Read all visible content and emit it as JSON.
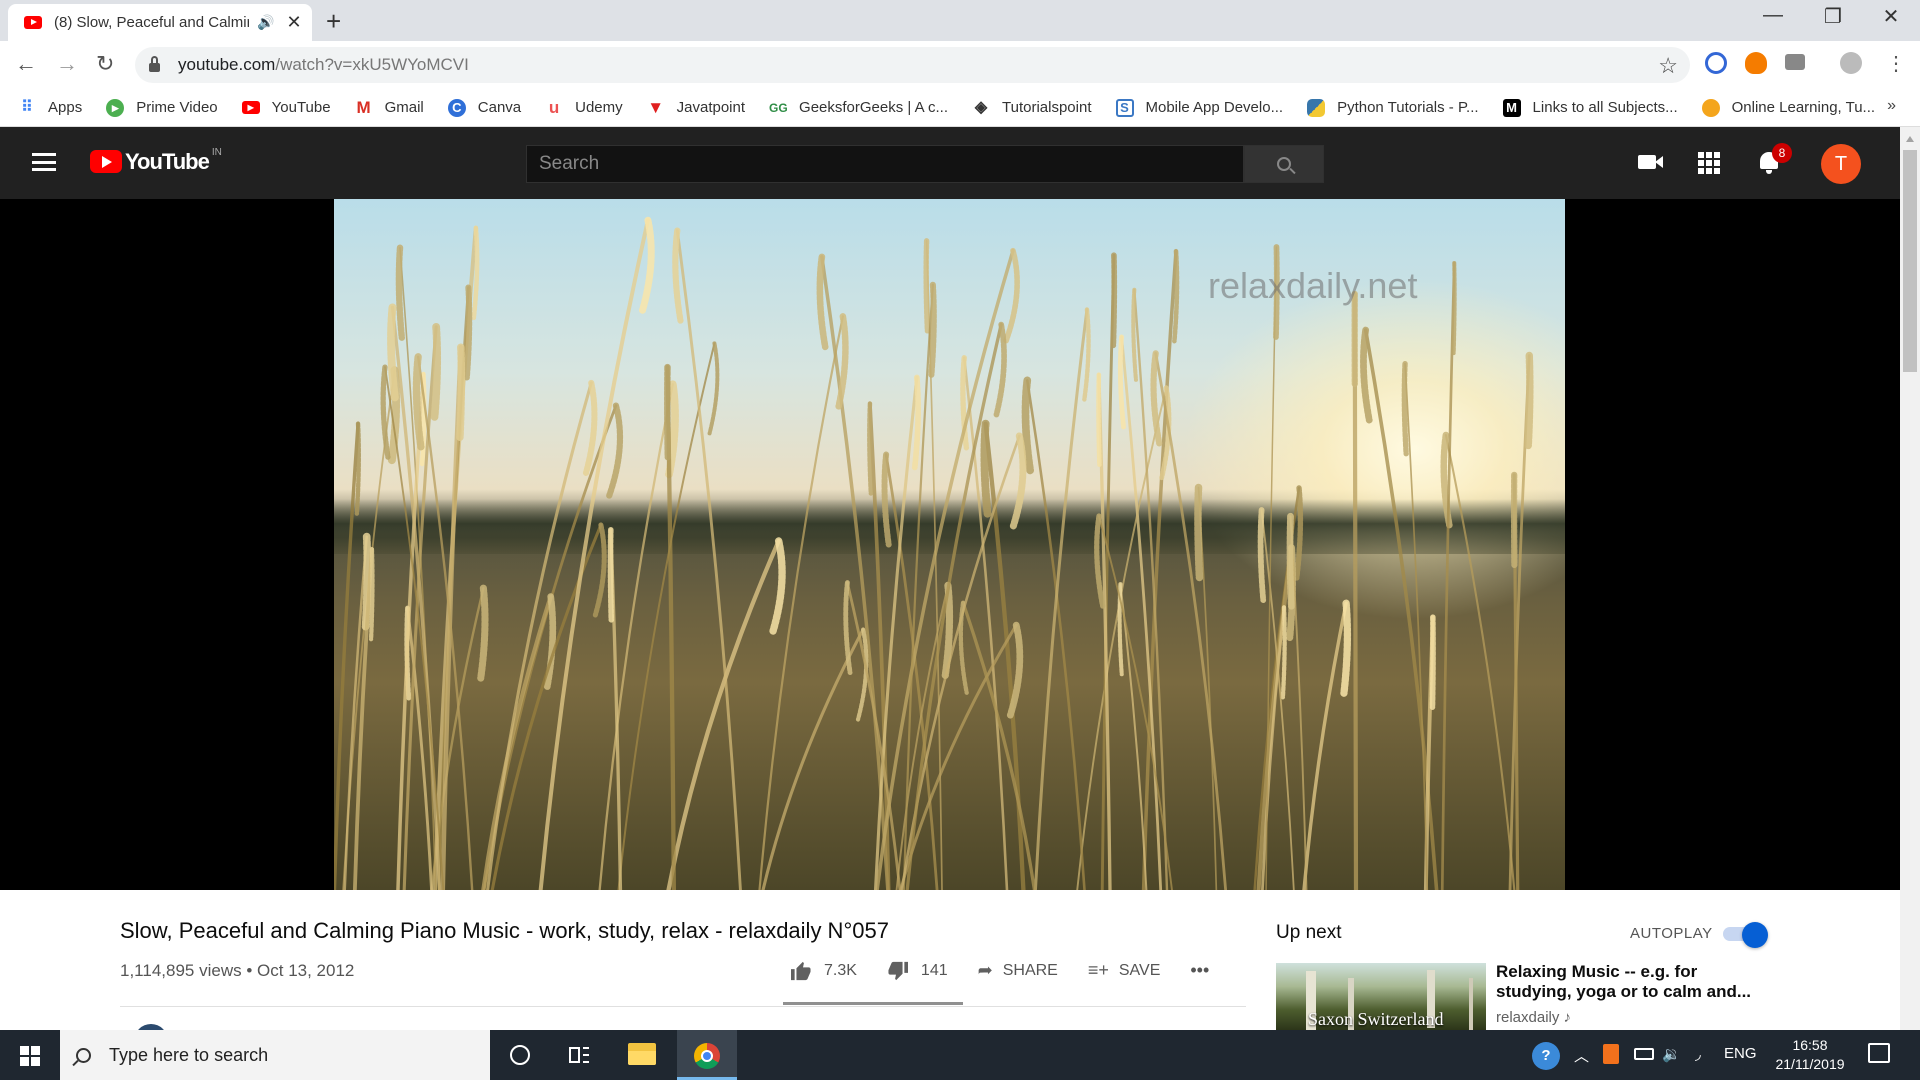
{
  "browser": {
    "tab_title": "(8) Slow, Peaceful and Calmir",
    "new_tab_symbol": "+",
    "url_host": "youtube.com",
    "url_path": "/watch?v=xkU5WYoMCVI",
    "window_controls": {
      "minimize": "—",
      "restore": "❐",
      "close": "✕"
    },
    "nav": {
      "back": "←",
      "forward": "→",
      "reload": "↻"
    }
  },
  "bookmarks": {
    "items": [
      {
        "label": "Apps",
        "icon": "apps-grid-icon",
        "color": "#4285f4"
      },
      {
        "label": "Prime Video",
        "icon": "prime-video-icon",
        "color": "#4caf50"
      },
      {
        "label": "YouTube",
        "icon": "youtube-icon",
        "color": "#ff0000"
      },
      {
        "label": "Gmail",
        "icon": "gmail-icon",
        "color": "#d93025"
      },
      {
        "label": "Canva",
        "icon": "canva-icon",
        "color": "#2f6fd8"
      },
      {
        "label": "Udemy",
        "icon": "udemy-icon",
        "color": "#ec5252"
      },
      {
        "label": "Javatpoint",
        "icon": "javatpoint-icon",
        "color": "#e02020"
      },
      {
        "label": "GeeksforGeeks | A c...",
        "icon": "geeksforgeeks-icon",
        "color": "#2f8d46"
      },
      {
        "label": "Tutorialspoint",
        "icon": "tutorialspoint-icon",
        "color": "#333333"
      },
      {
        "label": "Mobile App Develo...",
        "icon": "mobile-app-icon",
        "color": "#3b78c4"
      },
      {
        "label": "Python Tutorials - P...",
        "icon": "python-icon",
        "color": "#f2c832"
      },
      {
        "label": "Links to all Subjects...",
        "icon": "medium-icon",
        "color": "#000000"
      },
      {
        "label": "Online Learning, Tu...",
        "icon": "online-learning-icon",
        "color": "#f4a51c"
      }
    ],
    "more": "»"
  },
  "youtube": {
    "logo_text": "YouTube",
    "region": "IN",
    "search_placeholder": "Search",
    "notification_count": "8",
    "avatar_initial": "T",
    "watermark": "relaxdaily.net"
  },
  "video": {
    "title": "Slow, Peaceful and Calming Piano Music - work, study, relax - relaxdaily N°057",
    "views": "1,114,895 views",
    "date": "Oct 13, 2012",
    "likes": "7.3K",
    "dislikes": "141",
    "share_label": "SHARE",
    "save_label": "SAVE",
    "more_label": "•••"
  },
  "sidebar": {
    "up_next_label": "Up next",
    "autoplay_label": "AUTOPLAY",
    "autoplay_on": true,
    "next_video": {
      "thumbnail_text": "Saxon Switzerland",
      "title": "Relaxing Music -- e.g. for studying, yoga or to calm and...",
      "channel": "relaxdaily ♪"
    }
  },
  "taskbar": {
    "search_placeholder": "Type here to search",
    "language": "ENG",
    "time": "16:58",
    "date": "21/11/2019"
  }
}
